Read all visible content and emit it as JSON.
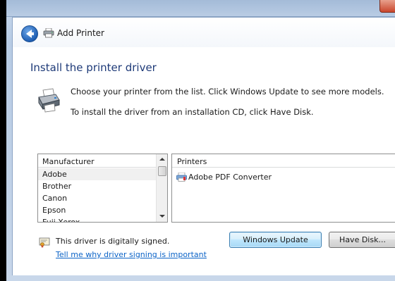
{
  "window": {
    "title": "Add Printer"
  },
  "page": {
    "heading": "Install the printer driver",
    "instruction_1": "Choose your printer from the list. Click Windows Update to see more models.",
    "instruction_2": "To install the driver from an installation CD, click Have Disk."
  },
  "manufacturer_list": {
    "header": "Manufacturer",
    "items": [
      "Adobe",
      "Brother",
      "Canon",
      "Epson",
      "Fuji Xerox"
    ],
    "selected": "Adobe"
  },
  "printers_list": {
    "header": "Printers",
    "items": [
      "Adobe PDF Converter"
    ]
  },
  "footer": {
    "signed_text": "This driver is digitally signed.",
    "signing_link": "Tell me why driver signing is important",
    "windows_update_label": "Windows Update",
    "have_disk_label": "Have Disk..."
  },
  "colors": {
    "heading": "#1e3a78",
    "link": "#0b63c7",
    "primary_button": "#a7d9f5"
  },
  "icons": {
    "back": "back-arrow-icon",
    "printer": "printer-icon",
    "shield": "certificate-icon",
    "pdf": "pdf-printer-icon"
  }
}
